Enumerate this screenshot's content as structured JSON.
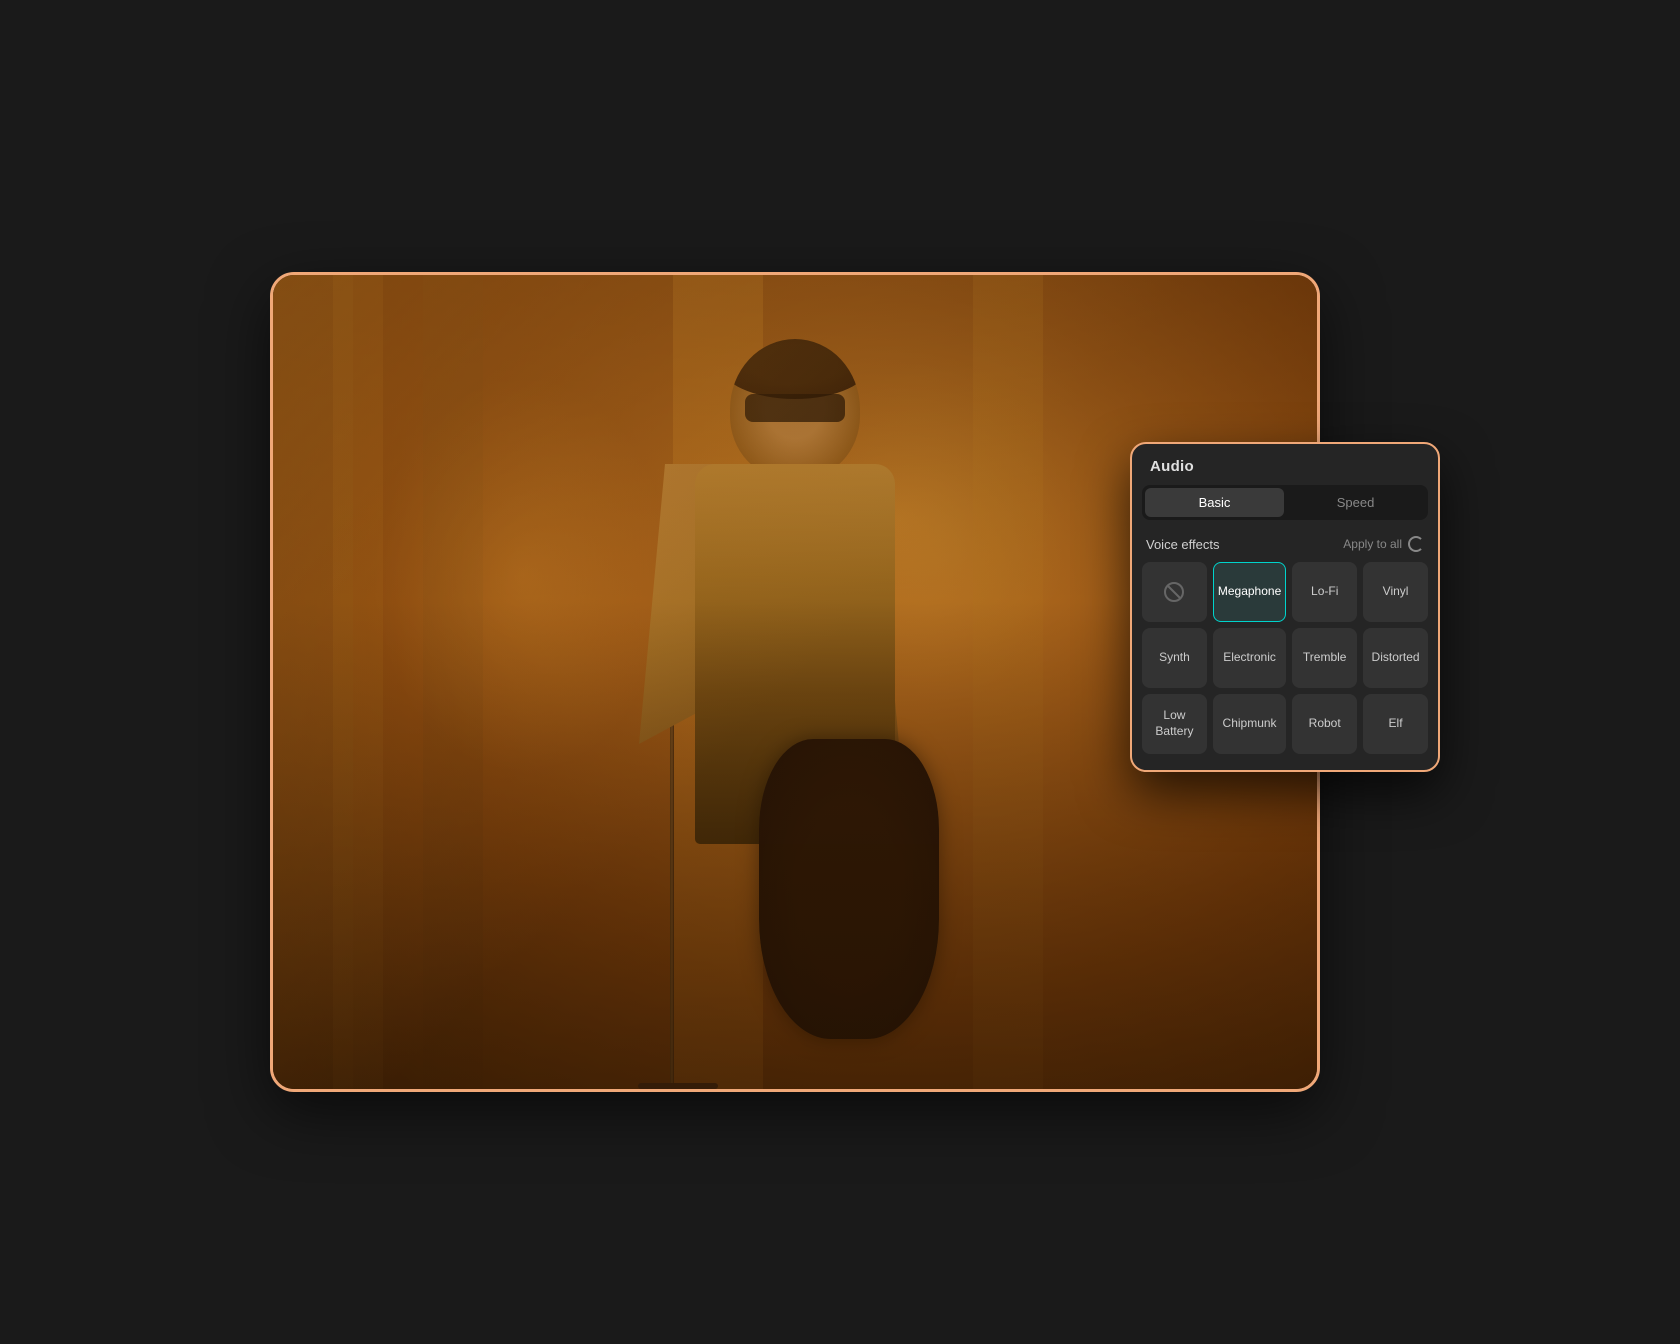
{
  "panel": {
    "title": "Audio",
    "tabs": [
      {
        "id": "basic",
        "label": "Basic",
        "active": true
      },
      {
        "id": "speed",
        "label": "Speed",
        "active": false
      }
    ],
    "voice_effects_label": "Voice effects",
    "apply_to_all_label": "Apply to all",
    "effects": [
      {
        "id": "none",
        "label": "",
        "is_icon": true,
        "selected": false,
        "row": 1
      },
      {
        "id": "megaphone",
        "label": "Megaphone",
        "selected": true,
        "row": 1
      },
      {
        "id": "lofi",
        "label": "Lo-Fi",
        "selected": false,
        "row": 1
      },
      {
        "id": "vinyl",
        "label": "Vinyl",
        "selected": false,
        "row": 1
      },
      {
        "id": "synth",
        "label": "Synth",
        "selected": false,
        "row": 2
      },
      {
        "id": "electronic",
        "label": "Electronic",
        "selected": false,
        "row": 2
      },
      {
        "id": "tremble",
        "label": "Tremble",
        "selected": false,
        "row": 2
      },
      {
        "id": "distorted",
        "label": "Distorted",
        "selected": false,
        "row": 2
      },
      {
        "id": "low-battery",
        "label": "Low Battery",
        "selected": false,
        "row": 3
      },
      {
        "id": "chipmunk",
        "label": "Chipmunk",
        "selected": false,
        "row": 3
      },
      {
        "id": "robot",
        "label": "Robot",
        "selected": false,
        "row": 3
      },
      {
        "id": "elf",
        "label": "Elf",
        "selected": false,
        "row": 3
      }
    ]
  }
}
